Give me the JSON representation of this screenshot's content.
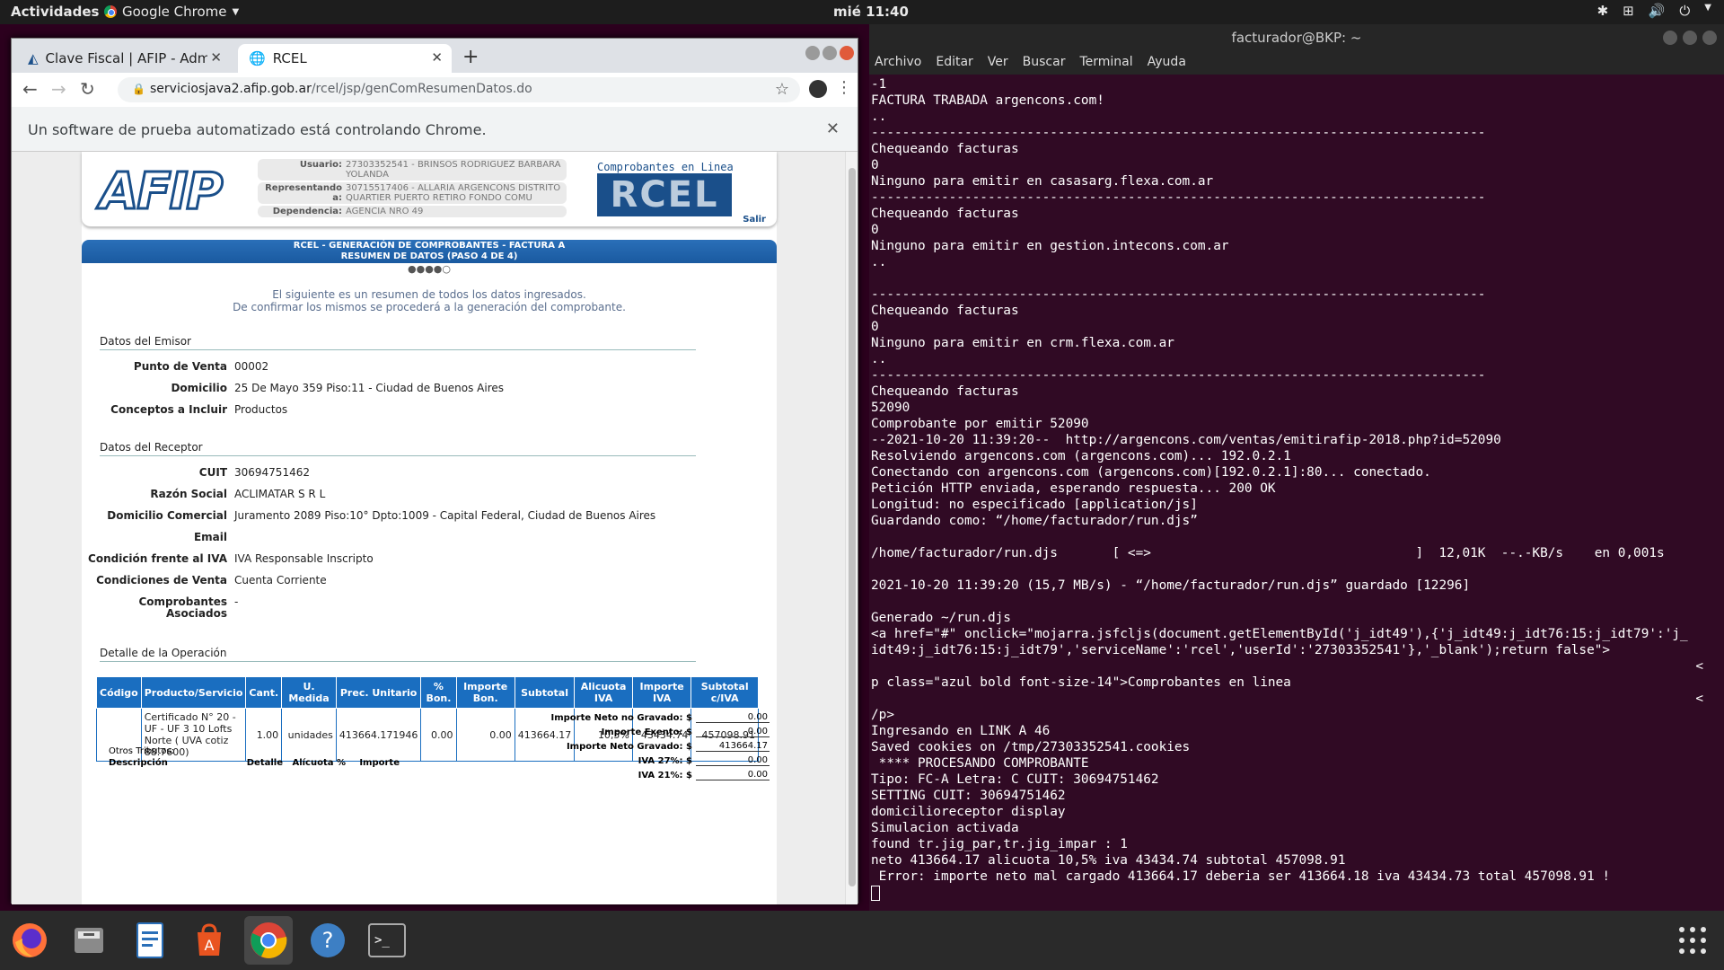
{
  "topbar": {
    "activities": "Actividades",
    "app": "Google Chrome",
    "clock": "mié 11:40"
  },
  "chrome": {
    "tabs": [
      {
        "title": "Clave Fiscal | AFIP - Admin"
      },
      {
        "title": "RCEL"
      }
    ],
    "url_host": "serviciosjava2.afip.gob.ar",
    "url_path": "/rcel/jsp/genComResumenDatos.do",
    "infobar": "Un software de prueba automatizado está controlando Chrome."
  },
  "page": {
    "logo_text": "AFIP",
    "user": {
      "usuario_label": "Usuario:",
      "usuario": "27303352541 - BRINSOS RODRIGUEZ BARBARA YOLANDA",
      "repr_label": "Representando a:",
      "repr": "30715517406 - ALLARIA ARGENCONS DISTRITO QUARTIER PUERTO RETIRO FONDO COMU",
      "dep_label": "Dependencia:",
      "dep": "AGENCIA NRO 49"
    },
    "rcel_tag": "Comprobantes en Linea",
    "rcel_logo": "RCEL",
    "salir": "Salir",
    "bar_line1": "RCEL - GENERACIÓN DE COMPROBANTES - FACTURA A",
    "bar_line2": "RESUMEN DE DATOS (PASO 4 DE 4)",
    "steps": "●●●●○",
    "intro1": "El siguiente es un resumen de todos los datos ingresados.",
    "intro2": "De confirmar los mismos se procederá a la generación del comprobante.",
    "emisor_title": "Datos del Emisor",
    "emisor": [
      {
        "k": "Punto de Venta",
        "v": "00002"
      },
      {
        "k": "Domicilio",
        "v": "25 De Mayo 359 Piso:11 - Ciudad de Buenos Aires"
      },
      {
        "k": "Conceptos a Incluir",
        "v": "Productos"
      }
    ],
    "receptor_title": "Datos del Receptor",
    "receptor": [
      {
        "k": "CUIT",
        "v": "30694751462"
      },
      {
        "k": "Razón Social",
        "v": "ACLIMATAR S R L"
      },
      {
        "k": "Domicilio Comercial",
        "v": "Juramento 2089 Piso:10° Dpto:1009 - Capital Federal, Ciudad de Buenos Aires"
      },
      {
        "k": "Email",
        "v": ""
      },
      {
        "k": "Condición frente al IVA",
        "v": "IVA Responsable Inscripto"
      },
      {
        "k": "Condiciones de Venta",
        "v": "Cuenta Corriente"
      },
      {
        "k": "Comprobantes Asociados",
        "v": "-"
      }
    ],
    "detalle_title": "Detalle de la Operación",
    "table_headers": [
      "Código",
      "Producto/Servicio",
      "Cant.",
      "U. Medida",
      "Prec. Unitario",
      "% Bon.",
      "Importe Bon.",
      "Subtotal",
      "Alicuota IVA",
      "Importe IVA",
      "Subtotal c/IVA"
    ],
    "table_row": [
      "",
      "Certificado N° 20 - UF - UF 3 10 Lofts Norte ( UVA cotiz 88.7600)",
      "1.00",
      "unidades",
      "413664.171946",
      "0.00",
      "0.00",
      "413664.17",
      "10,5%",
      "43434.74",
      "457098.91"
    ],
    "totals": [
      {
        "k": "Importe Neto no Gravado: $",
        "v": "0.00"
      },
      {
        "k": "Importe Exento: $",
        "v": "0.00"
      },
      {
        "k": "Importe Neto Gravado: $",
        "v": "413664.17"
      },
      {
        "k": "IVA 27%: $",
        "v": "0.00"
      },
      {
        "k": "IVA 21%: $",
        "v": "0.00"
      }
    ],
    "otros_title": "Otros Tributos:",
    "otros_cols": [
      "Descripción",
      "Detalle",
      "Alícuota %",
      "Importe"
    ]
  },
  "terminal": {
    "title": "facturador@BKP: ~",
    "menu": [
      "Archivo",
      "Editar",
      "Ver",
      "Buscar",
      "Terminal",
      "Ayuda"
    ],
    "lines": [
      "-1",
      "FACTURA TRABADA argencons.com!",
      "..",
      "-------------------------------------------------------------------------------",
      "Chequeando facturas",
      "0",
      "Ninguno para emitir en casasarg.flexa.com.ar",
      "-------------------------------------------------------------------------------",
      "Chequeando facturas",
      "0",
      "Ninguno para emitir en gestion.intecons.com.ar",
      "..",
      "",
      "-------------------------------------------------------------------------------",
      "Chequeando facturas",
      "0",
      "Ninguno para emitir en crm.flexa.com.ar",
      "..",
      "-------------------------------------------------------------------------------",
      "Chequeando facturas",
      "52090",
      "Comprobante por emitir 52090",
      "--2021-10-20 11:39:20--  http://argencons.com/ventas/emitirafip-2018.php?id=52090",
      "Resolviendo argencons.com (argencons.com)... 192.0.2.1",
      "Conectando con argencons.com (argencons.com)[192.0.2.1]:80... conectado.",
      "Petición HTTP enviada, esperando respuesta... 200 OK",
      "Longitud: no especificado [application/js]",
      "Guardando como: “/home/facturador/run.djs”",
      "",
      "/home/facturador/run.djs       [ <=>                                  ]  12,01K  --.-KB/s    en 0,001s",
      "",
      "2021-10-20 11:39:20 (15,7 MB/s) - “/home/facturador/run.djs” guardado [12296]",
      "",
      "Generado ~/run.djs",
      "<a href=\"#\" onclick=\"mojarra.jsfcljs(document.getElementById('j_idt49'),{'j_idt49:j_idt76:15:j_idt79':'j_",
      "idt49:j_idt76:15:j_idt79','serviceName':'rcel','userId':'27303352541'},'_blank');return false\">",
      "                                                                                                          <",
      "p class=\"azul bold font-size-14\">Comprobantes en linea",
      "                                                                                                          <",
      "/p>",
      "Ingresando en LINK A 46",
      "Saved cookies on /tmp/27303352541.cookies",
      " **** PROCESANDO COMPROBANTE",
      "Tipo: FC-A Letra: C CUIT: 30694751462",
      "SETTING CUIT: 30694751462",
      "domicilioreceptor display",
      "Simulacion activada",
      "found tr.jig_par,tr.jig_impar : 1",
      "neto 413664.17 alicuota 10,5% iva 43434.74 subtotal 457098.91",
      " Error: importe neto mal cargado 413664.17 deberia ser 413664.18 iva 43434.73 total 457098.91 !"
    ]
  }
}
